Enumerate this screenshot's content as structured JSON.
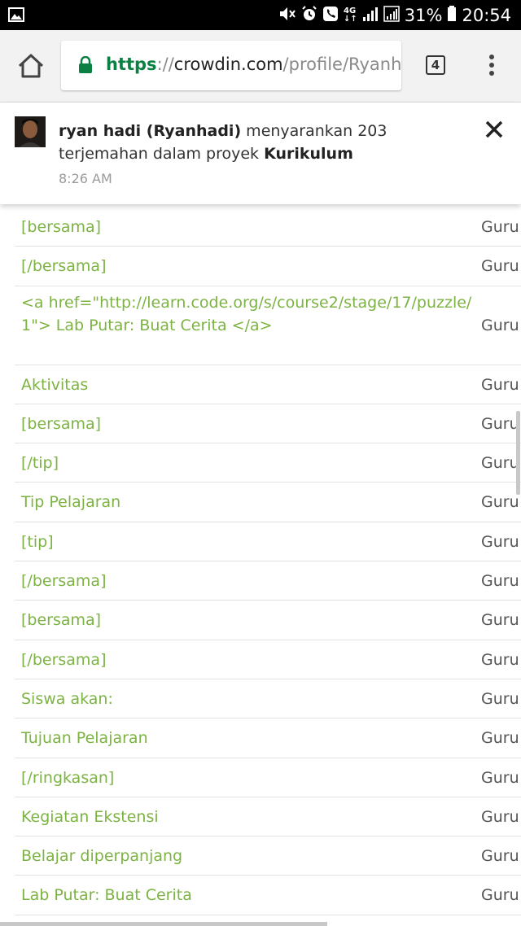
{
  "status_bar": {
    "battery_percent": "31%",
    "time": "20:54",
    "network_label": "4G"
  },
  "browser": {
    "url_scheme": "https",
    "url_separator": "://",
    "url_host": "crowdin.com",
    "url_path": "/profile/Ryanh",
    "tab_count": "4"
  },
  "notification": {
    "user": "ryan hadi (Ryanhadi)",
    "message": " menyarankan 203 terjemahan dalam proyek ",
    "project": "Kurikulum",
    "time": "8:26 AM"
  },
  "rows": [
    {
      "source": "[bersama]",
      "target": "Guru"
    },
    {
      "source": "[/bersama]",
      "target": "Guru"
    },
    {
      "source": "<a href=\"http://learn.code.org/s/course2/stage/17/puzzle/1\"> Lab Putar: Buat Cerita </a>",
      "target": "Guru"
    },
    {
      "source": "Aktivitas",
      "target": "Guru"
    },
    {
      "source": "[bersama]",
      "target": "Guru"
    },
    {
      "source": "[/tip]",
      "target": "Guru"
    },
    {
      "source": "Tip Pelajaran",
      "target": "Guru"
    },
    {
      "source": "[tip]",
      "target": "Guru"
    },
    {
      "source": "[/bersama]",
      "target": "Guru"
    },
    {
      "source": "[bersama]",
      "target": "Guru"
    },
    {
      "source": "[/bersama]",
      "target": "Guru"
    },
    {
      "source": "Siswa akan:",
      "target": "Guru"
    },
    {
      "source": "Tujuan Pelajaran",
      "target": "Guru"
    },
    {
      "source": "[/ringkasan]",
      "target": "Guru"
    },
    {
      "source": "Kegiatan Ekstensi",
      "target": "Guru"
    },
    {
      "source": "Belajar diperpanjang",
      "target": "Guru"
    },
    {
      "source": "Lab Putar: Buat Cerita",
      "target": "Guru"
    }
  ],
  "colors": {
    "link_green": "#7cb342",
    "url_green": "#0b8043"
  },
  "icons": [
    "gallery-icon",
    "mute-icon",
    "alarm-icon",
    "phone-icon",
    "signal-icon",
    "battery-icon",
    "home-icon",
    "lock-icon",
    "tabs-icon",
    "more-vert-icon",
    "close-icon"
  ]
}
